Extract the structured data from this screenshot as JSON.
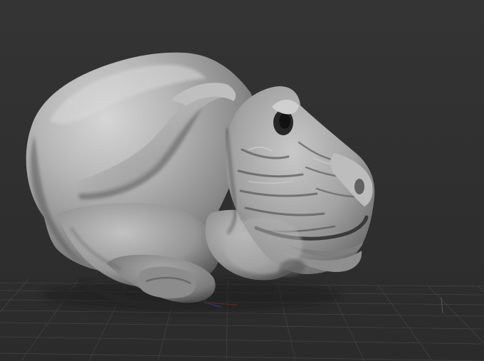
{
  "viewport": {
    "background_top": "#333333",
    "background_bottom": "#2a2a2a",
    "grid_color": "#4a4a4a",
    "axis_colors": {
      "x": "#b03a3a",
      "y": "#3a9a3a",
      "z": "#3a5ab0"
    },
    "model_colors": {
      "highlight": "#dcdcdc",
      "mid": "#a9a9a9",
      "shadow": "#4e4e4e",
      "deep_shadow": "#2b2b2b"
    }
  }
}
